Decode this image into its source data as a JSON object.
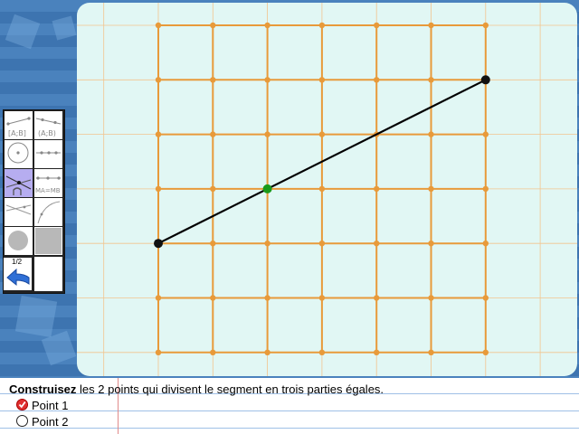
{
  "instruction": {
    "bold": "Construisez",
    "rest": " les 2 points qui divisent le segment en trois parties égales."
  },
  "tasks": [
    {
      "label": "Point 1",
      "done": true
    },
    {
      "label": "Point 2",
      "done": false
    }
  ],
  "toolbar": {
    "tools": [
      {
        "icon": "segment-icon",
        "label": "[A;B]"
      },
      {
        "icon": "segment-icon",
        "label": "(A;B)"
      },
      {
        "icon": "circle-icon",
        "label": ""
      },
      {
        "icon": "points-on-segment-icon",
        "label": ""
      },
      {
        "icon": "intersection-icon",
        "label": "",
        "active": true
      },
      {
        "icon": "midpoint-icon",
        "label": "MA=MB"
      },
      {
        "icon": "lines-icon",
        "label": ""
      },
      {
        "icon": "arc-icon",
        "label": ""
      },
      {
        "icon": "fill-circle-icon",
        "label": ""
      },
      {
        "icon": "fill-square-icon",
        "label": ""
      }
    ],
    "page": "1/2",
    "back_icon": "back-arrow-icon"
  },
  "colors": {
    "grid_line": "#e89a3a",
    "fine_grid": "#f2c48e",
    "board_bg": "#e1f7f4",
    "segment": "#000000",
    "point_placed": "#1a9a1a"
  }
}
